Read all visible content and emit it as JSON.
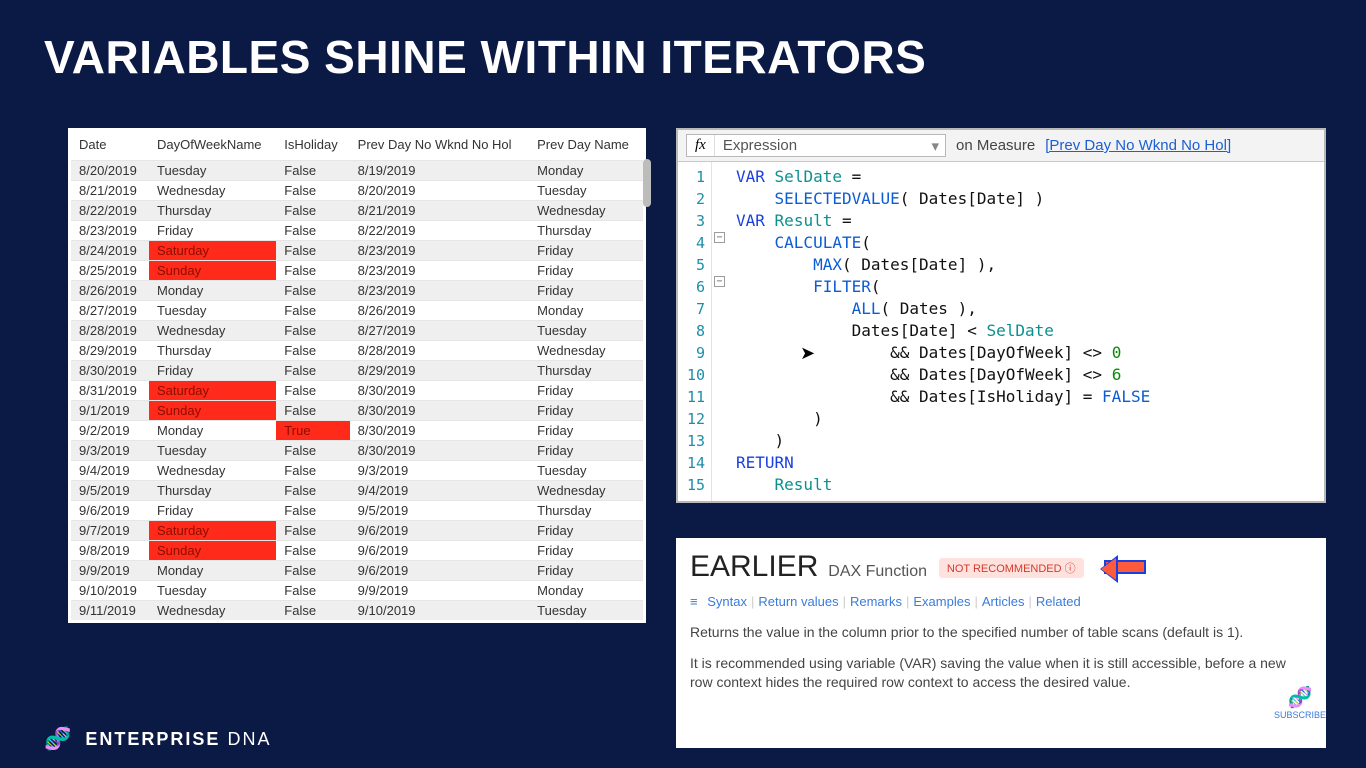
{
  "title": "VARIABLES SHINE WITHIN ITERATORS",
  "brand": {
    "name_a": "ENTERPRISE",
    "name_b": "DNA"
  },
  "subscribe": "SUBSCRIBE",
  "table": {
    "headers": [
      "Date",
      "DayOfWeekName",
      "IsHoliday",
      "Prev Day No Wknd No Hol",
      "Prev Day Name"
    ],
    "rows": [
      {
        "c": [
          "8/20/2019",
          "Tuesday",
          "False",
          "8/19/2019",
          "Monday"
        ]
      },
      {
        "c": [
          "8/21/2019",
          "Wednesday",
          "False",
          "8/20/2019",
          "Tuesday"
        ]
      },
      {
        "c": [
          "8/22/2019",
          "Thursday",
          "False",
          "8/21/2019",
          "Wednesday"
        ]
      },
      {
        "c": [
          "8/23/2019",
          "Friday",
          "False",
          "8/22/2019",
          "Thursday"
        ]
      },
      {
        "c": [
          "8/24/2019",
          "Saturday",
          "False",
          "8/23/2019",
          "Friday"
        ],
        "red": [
          1
        ]
      },
      {
        "c": [
          "8/25/2019",
          "Sunday",
          "False",
          "8/23/2019",
          "Friday"
        ],
        "red": [
          1
        ]
      },
      {
        "c": [
          "8/26/2019",
          "Monday",
          "False",
          "8/23/2019",
          "Friday"
        ]
      },
      {
        "c": [
          "8/27/2019",
          "Tuesday",
          "False",
          "8/26/2019",
          "Monday"
        ]
      },
      {
        "c": [
          "8/28/2019",
          "Wednesday",
          "False",
          "8/27/2019",
          "Tuesday"
        ]
      },
      {
        "c": [
          "8/29/2019",
          "Thursday",
          "False",
          "8/28/2019",
          "Wednesday"
        ]
      },
      {
        "c": [
          "8/30/2019",
          "Friday",
          "False",
          "8/29/2019",
          "Thursday"
        ]
      },
      {
        "c": [
          "8/31/2019",
          "Saturday",
          "False",
          "8/30/2019",
          "Friday"
        ],
        "red": [
          1
        ]
      },
      {
        "c": [
          "9/1/2019",
          "Sunday",
          "False",
          "8/30/2019",
          "Friday"
        ],
        "red": [
          1
        ]
      },
      {
        "c": [
          "9/2/2019",
          "Monday",
          "True",
          "8/30/2019",
          "Friday"
        ],
        "red": [
          2
        ]
      },
      {
        "c": [
          "9/3/2019",
          "Tuesday",
          "False",
          "8/30/2019",
          "Friday"
        ]
      },
      {
        "c": [
          "9/4/2019",
          "Wednesday",
          "False",
          "9/3/2019",
          "Tuesday"
        ]
      },
      {
        "c": [
          "9/5/2019",
          "Thursday",
          "False",
          "9/4/2019",
          "Wednesday"
        ]
      },
      {
        "c": [
          "9/6/2019",
          "Friday",
          "False",
          "9/5/2019",
          "Thursday"
        ]
      },
      {
        "c": [
          "9/7/2019",
          "Saturday",
          "False",
          "9/6/2019",
          "Friday"
        ],
        "red": [
          1
        ]
      },
      {
        "c": [
          "9/8/2019",
          "Sunday",
          "False",
          "9/6/2019",
          "Friday"
        ],
        "red": [
          1
        ]
      },
      {
        "c": [
          "9/9/2019",
          "Monday",
          "False",
          "9/6/2019",
          "Friday"
        ]
      },
      {
        "c": [
          "9/10/2019",
          "Tuesday",
          "False",
          "9/9/2019",
          "Monday"
        ]
      },
      {
        "c": [
          "9/11/2019",
          "Wednesday",
          "False",
          "9/10/2019",
          "Tuesday"
        ]
      }
    ]
  },
  "editor": {
    "fx_label": "Expression",
    "bar_text": "on Measure",
    "bar_link": "[Prev Day No Wknd No Hol]",
    "lines": 15,
    "code_html": "<span class='kw-blue'>VAR</span> <span class='kw-teal'>SelDate</span> =\n    <span class='kw-dblue'>SELECTEDVALUE</span>( Dates[Date] )\n<span class='kw-blue'>VAR</span> <span class='kw-teal'>Result</span> =\n    <span class='kw-dblue'>CALCULATE</span>(\n        <span class='kw-dblue'>MAX</span>( Dates[Date] ),\n        <span class='kw-dblue'>FILTER</span>(\n            <span class='kw-dblue'>ALL</span>( Dates ),\n            Dates[Date] &lt; <span class='kw-teal'>SelDate</span>\n                &amp;&amp; Dates[DayOfWeek] &lt;&gt; <span class='num'>0</span>\n                &amp;&amp; Dates[DayOfWeek] &lt;&gt; <span class='num'>6</span>\n                &amp;&amp; Dates[IsHoliday] = <span class='kw-dblue'>FALSE</span>\n        )\n    )\n<span class='kw-blue'>RETURN</span>\n    <span class='kw-teal'>Result</span>"
  },
  "doc": {
    "fn_name": "EARLIER",
    "fn_sub": "DAX Function",
    "badge": "NOT RECOMMENDED",
    "links": [
      "Syntax",
      "Return values",
      "Remarks",
      "Examples",
      "Articles",
      "Related"
    ],
    "p1": "Returns the value in the column prior to the specified number of table scans (default is 1).",
    "p2": "It is recommended using variable (VAR) saving the value when it is still accessible, before a new row context hides the required row context to access the desired value."
  }
}
